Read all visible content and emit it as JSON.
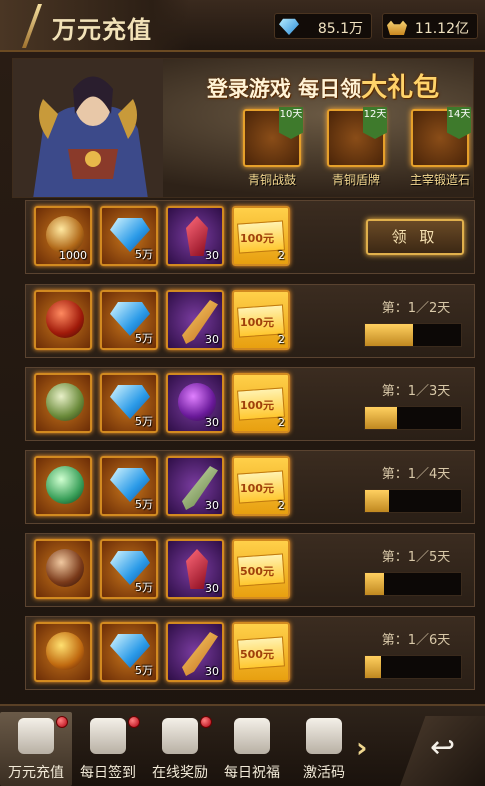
{
  "header": {
    "title": "万元充值",
    "diamonds": "85.1万",
    "ingots": "11.12亿"
  },
  "banner": {
    "title_prefix": "登录游戏 每日领",
    "title_big": "大礼包",
    "gifts": [
      {
        "days": "10天",
        "label": "青铜战鼓"
      },
      {
        "days": "12天",
        "label": "青铜盾牌"
      },
      {
        "days": "14天",
        "label": "主宰锻造石"
      }
    ]
  },
  "rows": [
    {
      "items": [
        {
          "icon": "orb-icon",
          "qty": "1000"
        },
        {
          "icon": "diamond-icon",
          "qty": "5万"
        },
        {
          "icon": "ruby-icon",
          "qty": "30"
        },
        {
          "icon": "voucher-icon",
          "label": "100元",
          "qty": "2"
        }
      ],
      "action": "领 取"
    },
    {
      "items": [
        {
          "icon": "amulet-icon",
          "qty": ""
        },
        {
          "icon": "diamond-icon",
          "qty": "5万"
        },
        {
          "icon": "feather-icon",
          "qty": "30"
        },
        {
          "icon": "voucher-icon",
          "label": "100元",
          "qty": "2"
        }
      ],
      "day": "第：1／2天",
      "progress": 0.5
    },
    {
      "items": [
        {
          "icon": "drum-icon",
          "qty": ""
        },
        {
          "icon": "diamond-icon",
          "qty": "5万"
        },
        {
          "icon": "dragon-icon",
          "qty": "30"
        },
        {
          "icon": "voucher-icon",
          "label": "100元",
          "qty": "2"
        }
      ],
      "day": "第：1／3天",
      "progress": 0.33
    },
    {
      "items": [
        {
          "icon": "pendant-icon",
          "qty": ""
        },
        {
          "icon": "diamond-icon",
          "qty": "5万"
        },
        {
          "icon": "herb-icon",
          "qty": "30"
        },
        {
          "icon": "voucher-icon",
          "label": "100元",
          "qty": "2"
        }
      ],
      "day": "第：1／4天",
      "progress": 0.25
    },
    {
      "items": [
        {
          "icon": "shield-icon",
          "qty": ""
        },
        {
          "icon": "diamond-icon",
          "qty": "5万"
        },
        {
          "icon": "ruby-icon",
          "qty": "30"
        },
        {
          "icon": "voucher-icon",
          "label": "500元",
          "qty": ""
        }
      ],
      "day": "第：1／5天",
      "progress": 0.2
    },
    {
      "items": [
        {
          "icon": "ring-icon",
          "qty": ""
        },
        {
          "icon": "diamond-icon",
          "qty": "5万"
        },
        {
          "icon": "feather-icon",
          "qty": "30"
        },
        {
          "icon": "voucher-icon",
          "label": "500元",
          "qty": ""
        }
      ],
      "day": "第：1／6天",
      "progress": 0.17
    }
  ],
  "nav": [
    {
      "label": "万元充值",
      "icon": "treasure-icon",
      "active": true,
      "dot": true
    },
    {
      "label": "每日签到",
      "icon": "sign-icon",
      "active": false,
      "dot": true
    },
    {
      "label": "在线奖励",
      "icon": "gift-bag-icon",
      "active": false,
      "dot": true
    },
    {
      "label": "每日祝福",
      "icon": "gift-box-icon",
      "active": false,
      "dot": false
    },
    {
      "label": "激活码",
      "icon": "chest-icon",
      "active": false,
      "dot": false
    }
  ],
  "colors": {
    "accent": "#e0a030",
    "progress": "#ffd060",
    "badge": "#3e7a2c"
  }
}
